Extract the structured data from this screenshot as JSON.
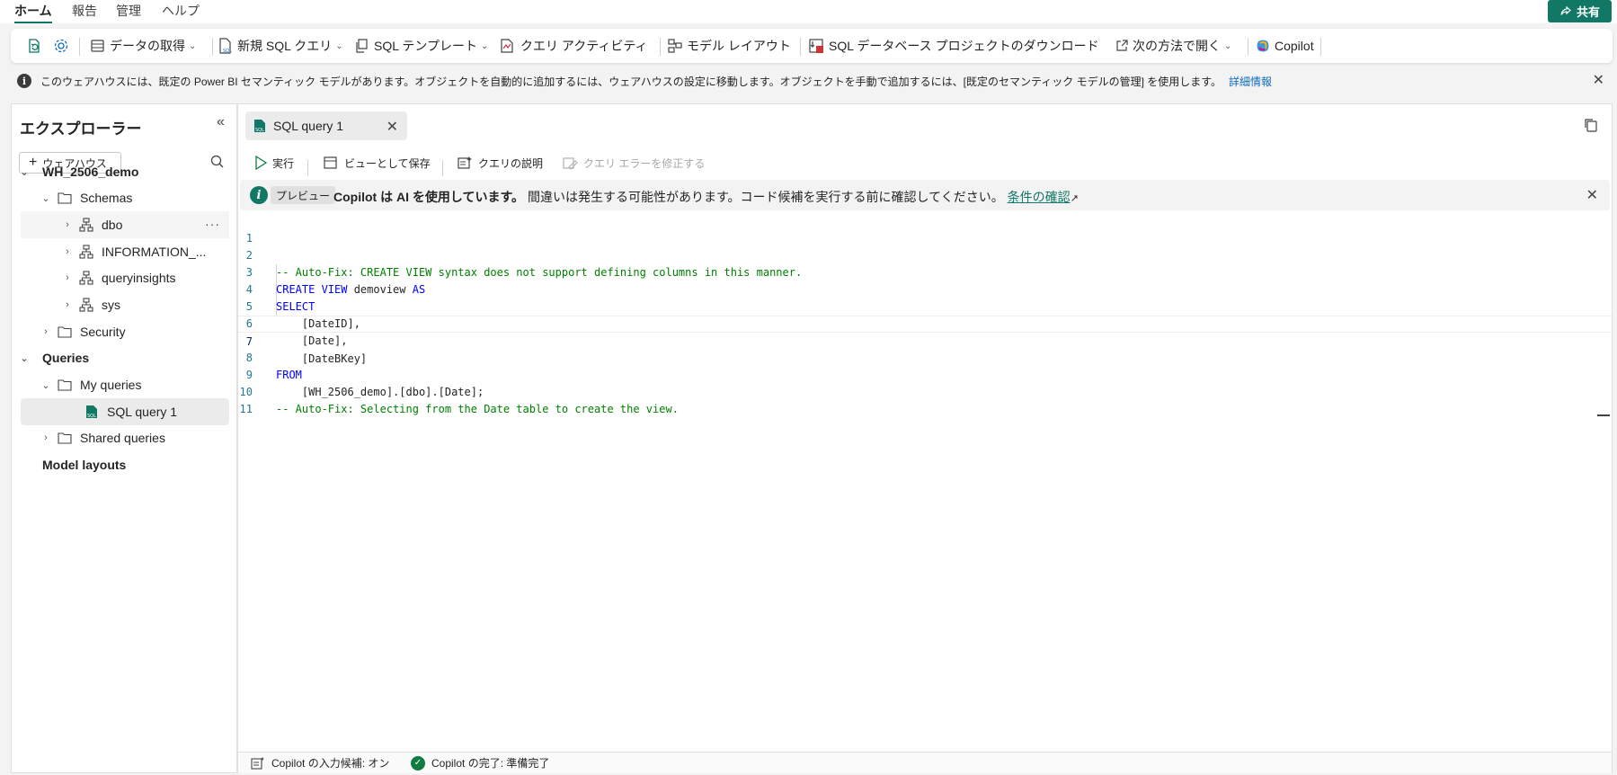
{
  "topnav": {
    "tabs": [
      "ホーム",
      "報告",
      "管理",
      "ヘルプ"
    ],
    "share_label": "共有"
  },
  "ribbon": {
    "get_data": "データの取得",
    "new_sql_query": "新規 SQL クエリ",
    "sql_template": "SQL テンプレート",
    "query_activity": "クエリ アクティビティ",
    "model_layout": "モデル レイアウト",
    "download_project": "SQL データベース プロジェクトのダウンロード",
    "open_in": "次の方法で開く",
    "copilot": "Copilot"
  },
  "banner": {
    "text": "このウェアハウスには、既定の Power BI セマンティック モデルがあります。オブジェクトを自動的に追加するには、ウェアハウスの設定に移動します。オブジェクトを手動で追加するには、[既定のセマンティック モデルの管理] を使用します。",
    "link": "詳細情報"
  },
  "explorer": {
    "title": "エクスプローラー",
    "add_warehouse": "ウェアハウス",
    "tree": {
      "warehouse": "WH_2506_demo",
      "schemas": "Schemas",
      "dbo": "dbo",
      "information_schema": "INFORMATION_...",
      "queryinsights": "queryinsights",
      "sys": "sys",
      "security": "Security",
      "queries": "Queries",
      "my_queries": "My queries",
      "sql_query_1": "SQL query 1",
      "shared_queries": "Shared queries",
      "model_layouts": "Model layouts"
    }
  },
  "editor": {
    "tab_label": "SQL query 1",
    "toolbar": {
      "run": "実行",
      "save_as_view": "ビューとして保存",
      "explain_query": "クエリの説明",
      "fix_errors": "クエリ エラーを修正する"
    },
    "copilot_bar": {
      "badge": "プレビュー",
      "bold_text": "Copilot は AI を使用しています。",
      "text": "間違いは発生する可能性があります。コード候補を実行する前に確認してください。",
      "link": "条件の確認"
    },
    "code_lines": [
      "",
      "-- Auto-Fix: CREATE VIEW syntax does not support defining columns in this manner.",
      "CREATE VIEW demoview AS",
      "SELECT",
      "    [DateID],",
      "    [Date],",
      "    [DateBKey]",
      "FROM",
      "    [WH_2506_demo].[dbo].[Date];",
      "-- Auto-Fix: Selecting from the Date table to create the view.",
      ""
    ],
    "line_numbers": [
      "1",
      "2",
      "3",
      "4",
      "5",
      "6",
      "7",
      "8",
      "9",
      "10",
      "11"
    ]
  },
  "statusbar": {
    "copilot_suggestions": "Copilot の入力候補: オン",
    "copilot_status": "Copilot の完了: 準備完了"
  },
  "colors": {
    "accent": "#117865",
    "keyword": "#0000ff",
    "comment": "#008000",
    "line_number": "#237893"
  }
}
